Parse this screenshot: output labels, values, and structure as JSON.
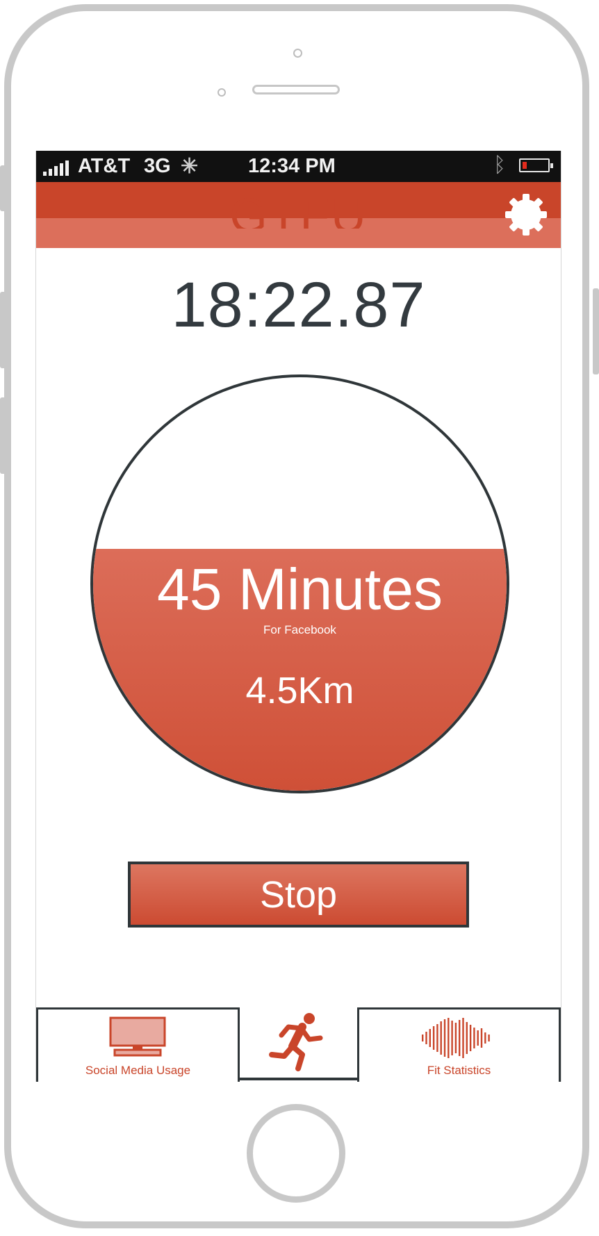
{
  "status_bar": {
    "carrier": "AT&T",
    "network": "3G",
    "time": "12:34 PM"
  },
  "nav": {
    "title": "GTFU",
    "settings_icon": "gear-icon"
  },
  "timer": "18:22.87",
  "progress": {
    "fill_fraction": 0.585,
    "minutes": "45 Minutes",
    "app": "For Facebook",
    "distance": "4.5Km"
  },
  "stop_label": "Stop",
  "tabs": [
    {
      "label": "Social Media Usage",
      "icon": "monitor-icon"
    },
    {
      "label": "",
      "icon": "running-man-icon"
    },
    {
      "label": "Fit Statistics",
      "icon": "waveform-icon"
    }
  ],
  "colors": {
    "accent": "#c9452a",
    "accent_light": "#dc6f5b",
    "outline": "#2f3639"
  }
}
